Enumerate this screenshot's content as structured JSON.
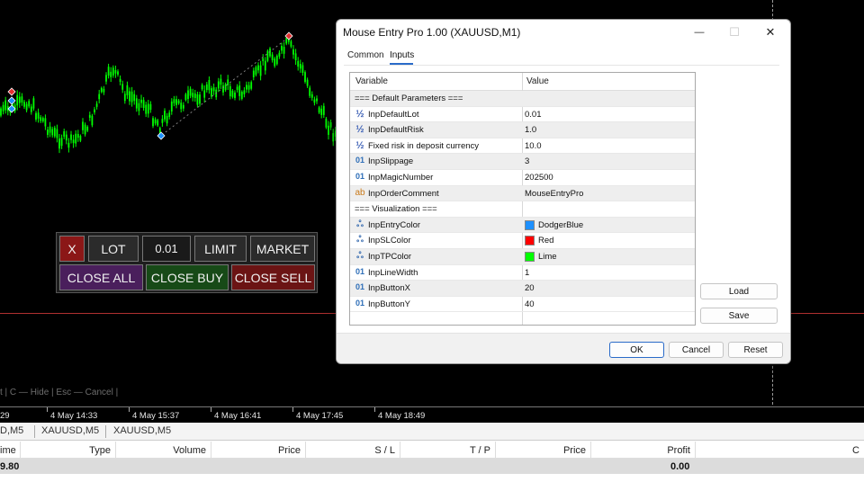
{
  "chart": {
    "hint_text": "t | C — Hide | Esc — Cancel |",
    "time_labels": [
      "29",
      "4 May 14:33",
      "4 May 15:37",
      "4 May 16:41",
      "4 May 17:45",
      "4 May 18:49"
    ],
    "colors": {
      "candles": "#00ff00",
      "level_line": "#b03030",
      "trendline": "#808080"
    }
  },
  "panel": {
    "close_label": "X",
    "lot_label": "LOT",
    "lot_value": "0.01",
    "limit_label": "LIMIT",
    "market_label": "MARKET",
    "close_all_label": "CLOSE ALL",
    "close_buy_label": "CLOSE BUY",
    "close_sell_label": "CLOSE SELL"
  },
  "terminal": {
    "tabs": [
      "D,M5",
      "XAUUSD,M5",
      "XAUUSD,M5"
    ],
    "columns": [
      "ime",
      "Type",
      "Volume",
      "Price",
      "S / L",
      "T / P",
      "Price",
      "Profit",
      "C"
    ],
    "row": {
      "first": "9.80",
      "profit": "0.00"
    }
  },
  "dialog": {
    "title": "Mouse Entry Pro 1.00 (XAUUSD,M1)",
    "window_buttons": {
      "minimize": "—",
      "maximize": "☐",
      "close": "✕"
    },
    "tabs": [
      "Common",
      "Inputs"
    ],
    "active_tab": "Inputs",
    "grid_headers": {
      "variable": "Variable",
      "value": "Value"
    },
    "rows": [
      {
        "type": "section",
        "variable": "=== Default Parameters ===",
        "value": ""
      },
      {
        "type": "double",
        "icon": "½",
        "variable": "InpDefaultLot",
        "value": "0.01"
      },
      {
        "type": "double",
        "icon": "½",
        "variable": "InpDefaultRisk",
        "value": "1.0"
      },
      {
        "type": "double",
        "icon": "½",
        "variable": "Fixed risk in deposit currency",
        "value": "10.0"
      },
      {
        "type": "int",
        "icon": "01",
        "variable": "InpSlippage",
        "value": "3"
      },
      {
        "type": "int",
        "icon": "01",
        "variable": "InpMagicNumber",
        "value": "202500"
      },
      {
        "type": "string",
        "icon": "ab",
        "variable": "InpOrderComment",
        "value": "MouseEntryPro"
      },
      {
        "type": "section",
        "variable": "=== Visualization ===",
        "value": ""
      },
      {
        "type": "color",
        "icon": "ஃ",
        "variable": "InpEntryColor",
        "value": "DodgerBlue",
        "swatch": "#1e90ff"
      },
      {
        "type": "color",
        "icon": "ஃ",
        "variable": "InpSLColor",
        "value": "Red",
        "swatch": "#ff0000"
      },
      {
        "type": "color",
        "icon": "ஃ",
        "variable": "InpTPColor",
        "value": "Lime",
        "swatch": "#00ff00"
      },
      {
        "type": "int",
        "icon": "01",
        "variable": "InpLineWidth",
        "value": "1"
      },
      {
        "type": "int",
        "icon": "01",
        "variable": "InpButtonX",
        "value": "20"
      },
      {
        "type": "int",
        "icon": "01",
        "variable": "InpButtonY",
        "value": "40"
      }
    ],
    "side_buttons": {
      "load": "Load",
      "save": "Save"
    },
    "footer_buttons": {
      "ok": "OK",
      "cancel": "Cancel",
      "reset": "Reset"
    }
  }
}
